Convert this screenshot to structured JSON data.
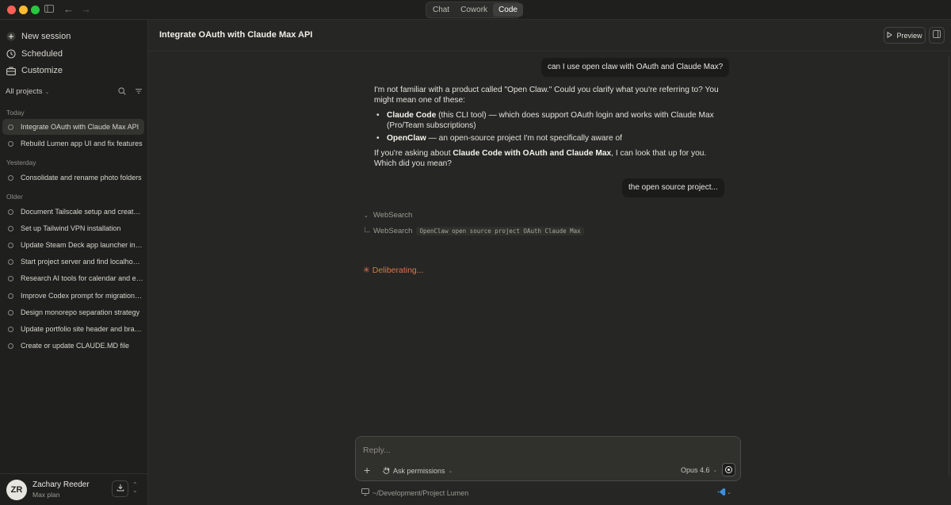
{
  "window": {
    "tabs": [
      {
        "label": "Chat",
        "active": false
      },
      {
        "label": "Cowork",
        "active": false
      },
      {
        "label": "Code",
        "active": true
      }
    ]
  },
  "sidebar": {
    "nav": [
      {
        "label": "New session",
        "icon": "plus-circle-icon"
      },
      {
        "label": "Scheduled",
        "icon": "clock-icon"
      },
      {
        "label": "Customize",
        "icon": "briefcase-icon"
      }
    ],
    "project_filter": "All projects",
    "groups": [
      {
        "label": "Today",
        "sessions": [
          "Integrate OAuth with Claude Max API",
          "Rebuild Lumen app UI and fix features"
        ]
      },
      {
        "label": "Yesterday",
        "sessions": [
          "Consolidate and rename photo folders"
        ]
      },
      {
        "label": "Older",
        "sessions": [
          "Document Tailscale setup and create c...",
          "Set up Tailwind VPN installation",
          "Update Steam Deck app launcher inter...",
          "Start project server and find localhost ...",
          "Research AI tools for calendar and em...",
          "Improve Codex prompt for migration pl...",
          "Design monorepo separation strategy",
          "Update portfolio site header and brand...",
          "Create or update CLAUDE.MD file"
        ]
      }
    ],
    "active_session": "Integrate OAuth with Claude Max API",
    "user": {
      "initials": "ZR",
      "name": "Zachary Reeder",
      "plan": "Max plan"
    }
  },
  "header": {
    "title": "Integrate OAuth with Claude Max API",
    "preview_label": "Preview"
  },
  "conversation": {
    "user_msg_1": "can I use open claw with OAuth and Claude Max?",
    "assistant": {
      "intro": "I'm not familiar with a product called \"Open Claw.\" Could you clarify what you're referring to? You might mean one of these:",
      "bullet_1_bold": "Claude Code",
      "bullet_1_rest": " (this CLI tool) — which does support OAuth login and works with Claude Max (Pro/Team subscriptions)",
      "bullet_2_bold": "OpenClaw",
      "bullet_2_rest": " — an open-source project I'm not specifically aware of",
      "outro_pre": "If you're asking about ",
      "outro_bold": "Claude Code with OAuth and Claude Max",
      "outro_post": ", I can look that up for you. Which did you mean?"
    },
    "user_msg_2": "the open source project...",
    "tool_group_label": "WebSearch",
    "tool_call_label": "WebSearch",
    "tool_query": "OpenClaw open source project OAuth Claude Max",
    "status": "Deliberating..."
  },
  "composer": {
    "placeholder": "Reply...",
    "permissions_label": "Ask permissions",
    "model": "Opus 4.6"
  },
  "footer": {
    "path": "~/Development/Project Lumen"
  },
  "colors": {
    "accent_status": "#d9774f",
    "background": "#262624",
    "sidebar": "#1f1f1d"
  }
}
